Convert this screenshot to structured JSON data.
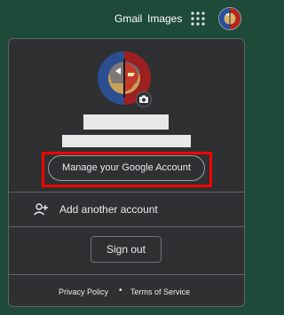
{
  "topbar": {
    "gmail_label": "Gmail",
    "images_label": "Images",
    "apps_icon": "apps-grid-icon",
    "avatar_icon": "profile-avatar-icon"
  },
  "account_panel": {
    "avatar_icon": "profile-avatar-icon",
    "camera_icon": "camera-icon",
    "manage_label": "Manage your Google Account",
    "add_account_label": "Add another account",
    "add_account_icon": "person-add-icon",
    "sign_out_label": "Sign out",
    "footer": {
      "privacy_label": "Privacy Policy",
      "separator": "•",
      "terms_label": "Terms of Service"
    }
  },
  "colors": {
    "page_background": "#1e4a3a",
    "panel_background": "#2f3032",
    "highlight": "#ff0000",
    "text": "#e8eaed"
  }
}
